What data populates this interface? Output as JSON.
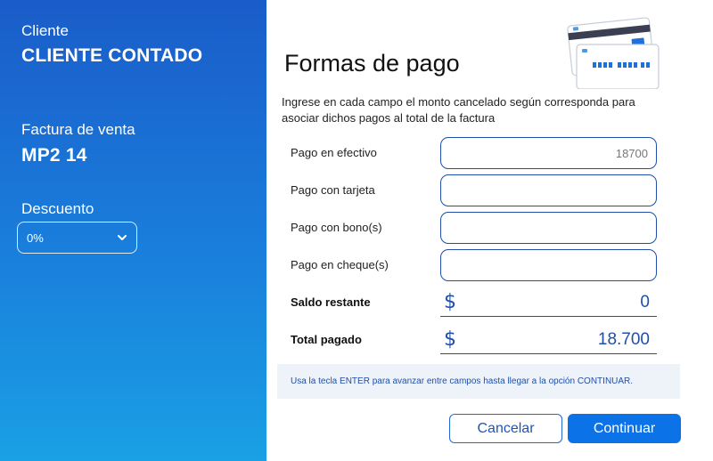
{
  "sidebar": {
    "client_label": "Cliente",
    "client_value": "CLIENTE CONTADO",
    "invoice_label": "Factura de venta",
    "invoice_value": "MP2 14",
    "discount_label": "Descuento",
    "discount_selected": "0%"
  },
  "main": {
    "title": "Formas de pago",
    "instructions": "Ingrese en cada campo el monto cancelado según corresponda para asociar dichos pagos al total de la factura",
    "fields": [
      {
        "label": "Pago en efectivo",
        "value": "18700"
      },
      {
        "label": "Pago con tarjeta",
        "value": ""
      },
      {
        "label": "Pago con bono(s)",
        "value": ""
      },
      {
        "label": "Pago en cheque(s)",
        "value": ""
      }
    ],
    "saldo_label": "Saldo restante",
    "saldo_currency": "$",
    "saldo_value": "0",
    "total_label": "Total pagado",
    "total_currency": "$",
    "total_value": "18.700",
    "hint": "Usa la tecla ENTER para avanzar entre campos hasta llegar a la opción CONTINUAR.",
    "cancel_label": "Cancelar",
    "continue_label": "Continuar"
  },
  "colors": {
    "sidebar_top": "#1a5cc9",
    "sidebar_bottom": "#1aa0e4",
    "accent": "#1f4fa8",
    "primary_button": "#0c72e8"
  },
  "icons": {
    "discount_dropdown": "chevron-down-icon",
    "illustration": "payment-cards-illustration"
  }
}
